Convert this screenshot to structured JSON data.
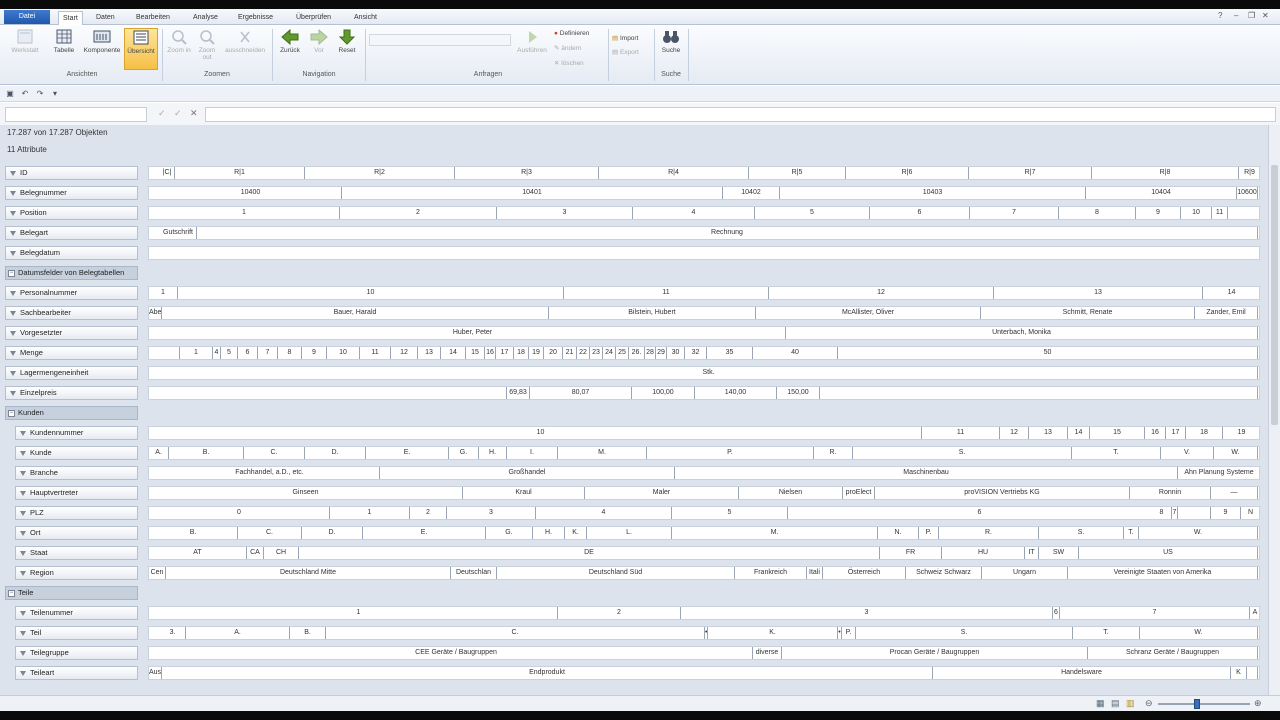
{
  "ribbon_tabs": [
    "Datei",
    "Start",
    "Daten",
    "Bearbeiten",
    "Analyse",
    "Ergebnisse",
    "Überprüfen",
    "Ansicht"
  ],
  "ribbon_buttons": {
    "werkstatt": "Werkstatt",
    "tabelle": "Tabelle",
    "komponente": "Komponente",
    "uebersicht": "Übersicht",
    "zoom_in": "Zoom in",
    "zoom_out": "Zoom out",
    "ausschneiden": "ausschneiden",
    "zurueck": "Zurück",
    "vor": "Vor",
    "reset": "Reset",
    "ausfuehren": "Ausführen",
    "definieren": "Definieren",
    "aendern": "ändern",
    "loeschen": "löschen",
    "import": "Import",
    "export": "Export",
    "suche": "Suche"
  },
  "ribbon_groups": {
    "ansichten": "Ansichten",
    "zoomen": "Zoomen",
    "navigation": "Navigation",
    "anfragen": "Anfragen",
    "suche": "Suche"
  },
  "header": {
    "objects": "17.287 von 17.287 Objekten",
    "attributes": "11 Attribute"
  },
  "rows": [
    {
      "label": "ID",
      "level": 1,
      "segs": [
        [
          "|C|",
          0.01,
          0.023
        ],
        [
          "R|1",
          0.023,
          0.14
        ],
        [
          "R|2",
          0.14,
          0.275
        ],
        [
          "R|3",
          0.275,
          0.405
        ],
        [
          "R|4",
          0.405,
          0.54
        ],
        [
          "R|5",
          0.54,
          0.627
        ],
        [
          "R|6",
          0.627,
          0.737
        ],
        [
          "R|7",
          0.737,
          0.848
        ],
        [
          "R|8",
          0.848,
          0.98
        ],
        [
          "R|9",
          0.98,
          1
        ]
      ]
    },
    {
      "label": "Belegnummer",
      "level": 1,
      "segs": [
        [
          "10400",
          0.01,
          0.174
        ],
        [
          "10401",
          0.174,
          0.516
        ],
        [
          "10402",
          0.516,
          0.567
        ],
        [
          "10403",
          0.567,
          0.843
        ],
        [
          "10404",
          0.843,
          0.978
        ],
        [
          "10600",
          0.978,
          0.997
        ]
      ]
    },
    {
      "label": "Position",
      "level": 1,
      "segs": [
        [
          "1",
          0.0,
          0.172
        ],
        [
          "2",
          0.172,
          0.313
        ],
        [
          "3",
          0.313,
          0.435
        ],
        [
          "4",
          0.435,
          0.545
        ],
        [
          "5",
          0.545,
          0.648
        ],
        [
          "6",
          0.648,
          0.738
        ],
        [
          "7",
          0.738,
          0.818
        ],
        [
          "8",
          0.818,
          0.888
        ],
        [
          "9",
          0.888,
          0.928
        ],
        [
          "10",
          0.928,
          0.956
        ],
        [
          "11",
          0.956,
          0.97
        ]
      ]
    },
    {
      "label": "Belegart",
      "level": 1,
      "segs": [
        [
          "Gutschrift",
          0.01,
          0.043
        ],
        [
          "Rechnung",
          0.043,
          0.997
        ]
      ]
    },
    {
      "label": "Belegdatum",
      "level": 1,
      "segs": []
    },
    {
      "label": "Datumsfelder von Belegtabellen",
      "level": 1,
      "group": true,
      "segs": null
    },
    {
      "label": "Personalnummer",
      "level": 1,
      "segs": [
        [
          "1",
          0.0,
          0.026
        ],
        [
          "10",
          0.026,
          0.373
        ],
        [
          "11",
          0.373,
          0.558
        ],
        [
          "12",
          0.558,
          0.76
        ],
        [
          "13",
          0.76,
          0.948
        ],
        [
          "14",
          0.948,
          1
        ]
      ]
    },
    {
      "label": "Sachbearbeiter",
      "level": 1,
      "segs": [
        [
          "Abe",
          0.0,
          0.012
        ],
        [
          "Bauer, Harald",
          0.012,
          0.36
        ],
        [
          "Bilstein, Hubert",
          0.36,
          0.546
        ],
        [
          "McAllister, Oliver",
          0.546,
          0.748
        ],
        [
          "Schmitt, Renate",
          0.748,
          0.941
        ],
        [
          "Zander, Emil",
          0.941,
          0.997
        ]
      ]
    },
    {
      "label": "Vorgesetzter",
      "level": 1,
      "segs": [
        [
          "Huber, Peter",
          0.01,
          0.573
        ],
        [
          "Unterbach, Monika",
          0.573,
          0.997
        ]
      ]
    },
    {
      "label": "Menge",
      "level": 1,
      "segs": [
        [
          "",
          0.0,
          0.028
        ],
        [
          "1",
          0.028,
          0.058
        ],
        [
          "4",
          0.058,
          0.065
        ],
        [
          "5",
          0.065,
          0.08
        ],
        [
          "6",
          0.08,
          0.098
        ],
        [
          "7",
          0.098,
          0.116
        ],
        [
          "8",
          0.116,
          0.138
        ],
        [
          "9",
          0.138,
          0.16
        ],
        [
          "10",
          0.16,
          0.19
        ],
        [
          "11",
          0.19,
          0.218
        ],
        [
          "12",
          0.218,
          0.242
        ],
        [
          "13",
          0.242,
          0.263
        ],
        [
          "14",
          0.263,
          0.285
        ],
        [
          "15",
          0.285,
          0.302
        ],
        [
          "16",
          0.302,
          0.312
        ],
        [
          "17",
          0.312,
          0.328
        ],
        [
          "18",
          0.328,
          0.342
        ],
        [
          "19",
          0.342,
          0.355
        ],
        [
          "20",
          0.355,
          0.372
        ],
        [
          "21",
          0.372,
          0.385
        ],
        [
          "22",
          0.385,
          0.397
        ],
        [
          "23",
          0.397,
          0.408
        ],
        [
          "24",
          0.408,
          0.42
        ],
        [
          "25",
          0.42,
          0.432
        ],
        [
          "26.",
          0.432,
          0.446
        ],
        [
          "28",
          0.446,
          0.456
        ],
        [
          "29",
          0.456,
          0.466
        ],
        [
          "30",
          0.466,
          0.482
        ],
        [
          "32",
          0.482,
          0.502
        ],
        [
          "35",
          0.502,
          0.543
        ],
        [
          "40",
          0.543,
          0.62
        ],
        [
          "50",
          0.62,
          0.997
        ]
      ]
    },
    {
      "label": "Lagermengeneinheit",
      "level": 1,
      "segs": [
        [
          "Stk.",
          0.01,
          0.997
        ]
      ]
    },
    {
      "label": "Einzelpreis",
      "level": 1,
      "segs": [
        [
          "",
          0.0,
          0.322
        ],
        [
          "69,83",
          0.322,
          0.343
        ],
        [
          "80,07",
          0.343,
          0.434
        ],
        [
          "100,00",
          0.434,
          0.491
        ],
        [
          "140,00",
          0.491,
          0.565
        ],
        [
          "150,00",
          0.565,
          0.603
        ],
        [
          "",
          0.603,
          0.997
        ]
      ]
    },
    {
      "label": "Kunden",
      "level": 0,
      "group": true,
      "expander": true,
      "segs": null
    },
    {
      "label": "Kundennummer",
      "level": 2,
      "segs": [
        [
          "10",
          0.01,
          0.695
        ],
        [
          "11",
          0.695,
          0.765
        ],
        [
          "12",
          0.765,
          0.791
        ],
        [
          "13",
          0.791,
          0.826
        ],
        [
          "14",
          0.826,
          0.846
        ],
        [
          "15",
          0.846,
          0.896
        ],
        [
          "16",
          0.896,
          0.915
        ],
        [
          "17",
          0.915,
          0.933
        ],
        [
          "18",
          0.933,
          0.966
        ],
        [
          "19",
          0.966,
          1
        ]
      ]
    },
    {
      "label": "Kunde",
      "level": 2,
      "segs": [
        [
          "A.",
          0.0,
          0.018
        ],
        [
          "B.",
          0.018,
          0.085
        ],
        [
          "C.",
          0.085,
          0.14
        ],
        [
          "D.",
          0.14,
          0.195
        ],
        [
          "E.",
          0.195,
          0.27
        ],
        [
          "G.",
          0.27,
          0.297
        ],
        [
          "H.",
          0.297,
          0.322
        ],
        [
          "I.",
          0.322,
          0.368
        ],
        [
          "M.",
          0.368,
          0.448
        ],
        [
          "P.",
          0.448,
          0.598
        ],
        [
          "R.",
          0.598,
          0.633
        ],
        [
          "S.",
          0.633,
          0.83
        ],
        [
          "T.",
          0.83,
          0.91
        ],
        [
          "V.",
          0.91,
          0.958
        ],
        [
          "W.",
          0.958,
          0.997
        ]
      ]
    },
    {
      "label": "Branche",
      "level": 2,
      "segs": [
        [
          "Fachhandel, a.D., etc.",
          0.01,
          0.208
        ],
        [
          "Großhandel",
          0.208,
          0.473
        ],
        [
          "Maschinenbau",
          0.473,
          0.925
        ],
        [
          "Ahn Planung Systeme",
          0.925,
          1
        ]
      ]
    },
    {
      "label": "Hauptvertreter",
      "level": 2,
      "segs": [
        [
          "Ginseen",
          0.0,
          0.282
        ],
        [
          "Kraul",
          0.282,
          0.392
        ],
        [
          "Maler",
          0.392,
          0.531
        ],
        [
          "Nielsen",
          0.531,
          0.624
        ],
        [
          "proElect",
          0.624,
          0.653
        ],
        [
          "proVISION Vertriebs KG",
          0.653,
          0.882
        ],
        [
          "Ronnin",
          0.882,
          0.955
        ],
        [
          "—",
          0.955,
          0.997
        ]
      ]
    },
    {
      "label": "PLZ",
      "level": 2,
      "segs": [
        [
          "0",
          0.0,
          0.163
        ],
        [
          "1",
          0.163,
          0.235
        ],
        [
          "2",
          0.235,
          0.268
        ],
        [
          "3",
          0.268,
          0.348
        ],
        [
          "4",
          0.348,
          0.47
        ],
        [
          "5",
          0.47,
          0.575
        ],
        [
          "6",
          0.575,
          0.92
        ],
        [
          "7",
          0.92,
          0.867
        ],
        [
          "8",
          0.867,
          0.955
        ],
        [
          "9",
          0.955,
          0.982
        ],
        [
          "N",
          0.982,
          1
        ]
      ]
    },
    {
      "label": "Ort",
      "level": 2,
      "segs": [
        [
          "B.",
          0.0,
          0.08
        ],
        [
          "C.",
          0.08,
          0.138
        ],
        [
          "D.",
          0.138,
          0.192
        ],
        [
          "E.",
          0.192,
          0.303
        ],
        [
          "G.",
          0.303,
          0.345
        ],
        [
          "H.",
          0.345,
          0.374
        ],
        [
          "K.",
          0.374,
          0.394
        ],
        [
          "L.",
          0.394,
          0.47
        ],
        [
          "M.",
          0.47,
          0.656
        ],
        [
          "N.",
          0.656,
          0.692
        ],
        [
          "P.",
          0.692,
          0.71
        ],
        [
          "R.",
          0.71,
          0.8
        ],
        [
          "S.",
          0.8,
          0.877
        ],
        [
          "T.",
          0.877,
          0.89
        ],
        [
          "W.",
          0.89,
          0.997
        ]
      ]
    },
    {
      "label": "Staat",
      "level": 2,
      "segs": [
        [
          "AT",
          0.0,
          0.088
        ],
        [
          "CA",
          0.088,
          0.103
        ],
        [
          "CH",
          0.103,
          0.135
        ],
        [
          "DE",
          0.135,
          0.657
        ],
        [
          "FR",
          0.657,
          0.713
        ],
        [
          "HU",
          0.713,
          0.788
        ],
        [
          "IT",
          0.788,
          0.8
        ],
        [
          "SW",
          0.8,
          0.836
        ],
        [
          "US",
          0.836,
          0.997
        ]
      ]
    },
    {
      "label": "Region",
      "level": 2,
      "segs": [
        [
          "Cen",
          0.0,
          0.015
        ],
        [
          "Deutschland Mitte",
          0.015,
          0.272
        ],
        [
          "Deutschlan",
          0.272,
          0.313
        ],
        [
          "Deutschland Süd",
          0.313,
          0.527
        ],
        [
          "Frankreich",
          0.527,
          0.592
        ],
        [
          "Itali",
          0.592,
          0.606
        ],
        [
          "Österreich",
          0.606,
          0.681
        ],
        [
          "Schweiz Schwarz",
          0.681,
          0.749
        ],
        [
          "Ungarn",
          0.749,
          0.826
        ],
        [
          "Vereinigte Staaten von Amerika",
          0.826,
          0.997
        ]
      ]
    },
    {
      "label": "Teile",
      "level": 0,
      "group": true,
      "expander": true,
      "segs": null
    },
    {
      "label": "Teilenummer",
      "level": 2,
      "segs": [
        [
          "1",
          0.01,
          0.368
        ],
        [
          "2",
          0.368,
          0.478
        ],
        [
          "3",
          0.478,
          0.813
        ],
        [
          "6",
          0.813,
          0.819
        ],
        [
          "7",
          0.819,
          0.99
        ],
        [
          "A",
          0.99,
          1
        ]
      ]
    },
    {
      "label": "Teil",
      "level": 2,
      "segs": [
        [
          "3.",
          0.01,
          0.033
        ],
        [
          "A.",
          0.033,
          0.127
        ],
        [
          "B.",
          0.127,
          0.159
        ],
        [
          "C.",
          0.159,
          0.5
        ],
        [
          "•",
          0.5,
          0.503
        ],
        [
          "K.",
          0.503,
          0.62
        ],
        [
          "•",
          0.62,
          0.623
        ],
        [
          "P.",
          0.623,
          0.636
        ],
        [
          "S.",
          0.636,
          0.831
        ],
        [
          "T.",
          0.831,
          0.891
        ],
        [
          "W.",
          0.891,
          0.997
        ]
      ]
    },
    {
      "label": "Teilegruppe",
      "level": 2,
      "segs": [
        [
          "CEE Geräte / Baugruppen",
          0.01,
          0.543
        ],
        [
          "diverse",
          0.543,
          0.569
        ],
        [
          "Procan Geräte / Baugruppen",
          0.569,
          0.844
        ],
        [
          "Schranz Geräte / Baugruppen",
          0.844,
          0.997
        ]
      ]
    },
    {
      "label": "Teileart",
      "level": 2,
      "segs": [
        [
          "Aus",
          0.0,
          0.012
        ],
        [
          "Endprodukt",
          0.012,
          0.705
        ],
        [
          "Handelsware",
          0.705,
          0.973
        ],
        [
          "K",
          0.973,
          0.987
        ],
        [
          "",
          0.987,
          0.997
        ]
      ]
    }
  ]
}
